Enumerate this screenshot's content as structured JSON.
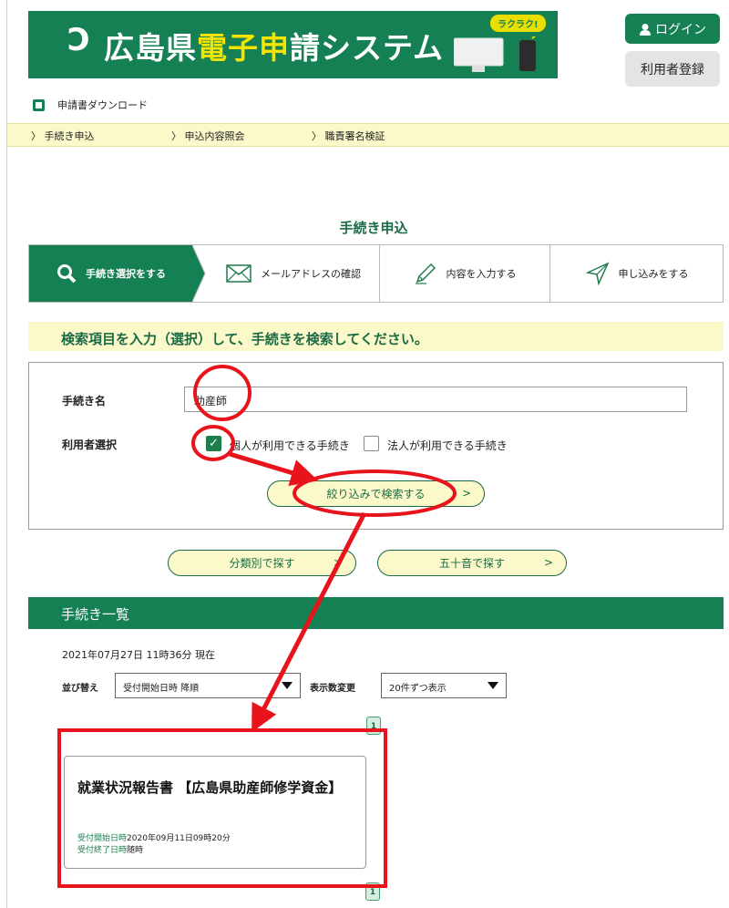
{
  "header": {
    "logo_mark": "Ɔ",
    "title_parts": [
      "広島県",
      "電子",
      "申",
      "請システム"
    ],
    "badge": "ラクラク!",
    "login_label": "ログイン",
    "register_label": "利用者登録"
  },
  "download_link": "申請書ダウンロード",
  "nav": [
    "手続き申込",
    "申込内容照会",
    "職責署名検証"
  ],
  "page_title": "手続き申込",
  "steps": [
    {
      "label": "手続き選択をする",
      "icon": "search-icon"
    },
    {
      "label": "メールアドレスの確認",
      "icon": "envelope-icon"
    },
    {
      "label": "内容を入力する",
      "icon": "pencil-icon"
    },
    {
      "label": "申し込みをする",
      "icon": "paper-plane-icon"
    }
  ],
  "instruction": "検索項目を入力（選択）して、手続きを検索してください。",
  "search": {
    "name_label": "手続き名",
    "name_value": "助産師",
    "user_label": "利用者選択",
    "option_individual": "個人が利用できる手続き",
    "option_corporate": "法人が利用できる手続き",
    "filter_button": "絞り込みで検索する",
    "category_button": "分類別で探す",
    "kana_button": "五十音で探す"
  },
  "list": {
    "header": "手続き一覧",
    "timestamp": "2021年07月27日 11時36分 現在",
    "sort_label": "並び替え",
    "sort_value": "受付開始日時 降順",
    "count_label": "表示数変更",
    "count_value": "20件ずつ表示",
    "page_top": "1",
    "page_bottom": "1",
    "item": {
      "title": "就業状況報告書 【広島県助産師修学資金】",
      "start_label": "受付開始日時",
      "start_value": "2020年09月11日09時20分",
      "end_label": "受付終了日時",
      "end_value": "随時"
    }
  },
  "colors": {
    "brand_green": "#158053",
    "highlight_yellow": "#fbf8c9",
    "annotation_red": "#e8141c"
  }
}
